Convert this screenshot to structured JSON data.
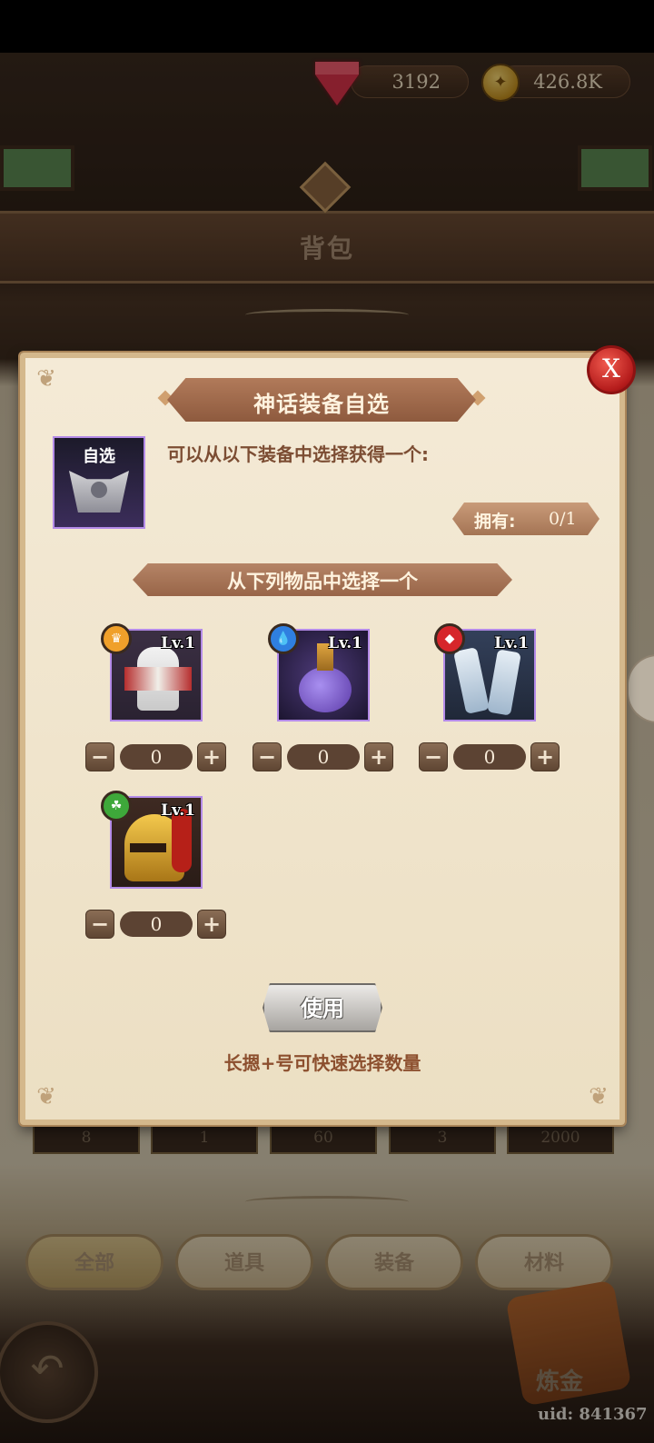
{
  "header": {
    "gems": "3192",
    "gold": "426.8K",
    "title": "背包"
  },
  "modal": {
    "title": "神话装备自选",
    "close_label": "X",
    "selector_item_label": "自选",
    "description": "可以从以下装备中选择获得一个:",
    "owned_label": "拥有:",
    "owned_value": "0/1",
    "choose_banner": "从下列物品中选择一个",
    "items": [
      {
        "level": "Lv.1",
        "badge_color": "#f0a02a",
        "icon": "armor-icon",
        "quantity": "0"
      },
      {
        "level": "Lv.1",
        "badge_color": "#2f7fe0",
        "icon": "potion-icon",
        "quantity": "0"
      },
      {
        "level": "Lv.1",
        "badge_color": "#d6262b",
        "icon": "gauntlets-icon",
        "quantity": "0"
      },
      {
        "level": "Lv.1",
        "badge_color": "#3ea83a",
        "icon": "helmet-icon",
        "quantity": "0"
      }
    ],
    "minus_label": "−",
    "plus_label": "+",
    "use_button": "使用",
    "hint": "长摁+号可快速选择数量"
  },
  "background_grid": {
    "counts": [
      "8",
      "1",
      "60",
      "3",
      "2000"
    ]
  },
  "bottom_tabs": [
    "全部",
    "道具",
    "装备",
    "材料"
  ],
  "alchemy_label": "炼金",
  "uid": "uid: 841367"
}
